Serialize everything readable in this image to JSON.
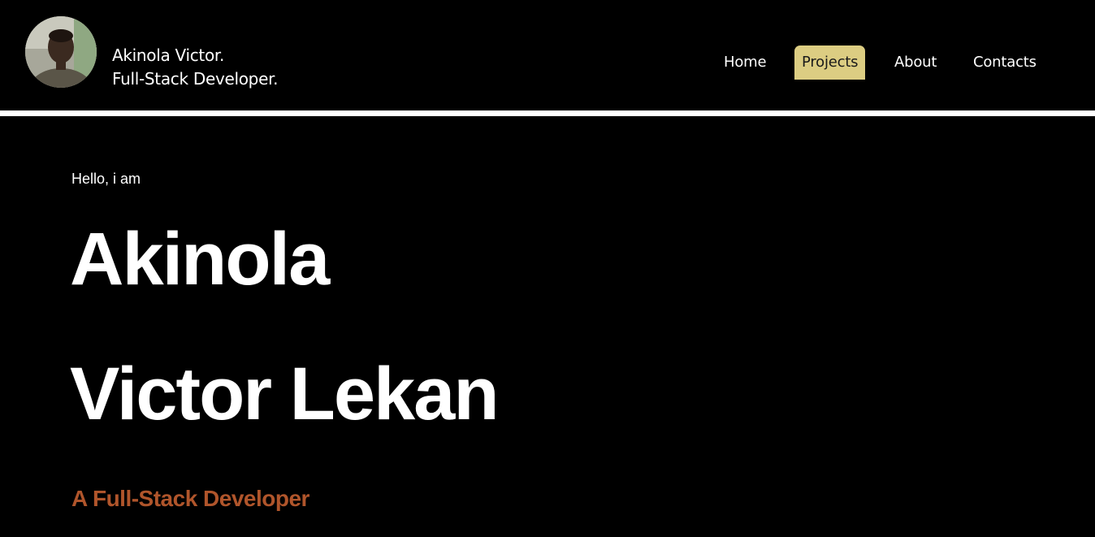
{
  "header": {
    "brand": {
      "name": "Akinola Victor.",
      "title": "Full-Stack Developer."
    },
    "nav": [
      {
        "label": "Home",
        "active": false
      },
      {
        "label": "Projects",
        "active": true
      },
      {
        "label": "About",
        "active": false
      },
      {
        "label": "Contacts",
        "active": false
      }
    ]
  },
  "hero": {
    "greeting": "Hello, i am",
    "name_line_1": "Akinola",
    "name_line_2": "Victor Lekan",
    "role": "A Full-Stack Developer"
  },
  "colors": {
    "background": "#000000",
    "active_nav": "#dccd82",
    "role_text": "#b0552b",
    "divider": "#ffffff"
  }
}
